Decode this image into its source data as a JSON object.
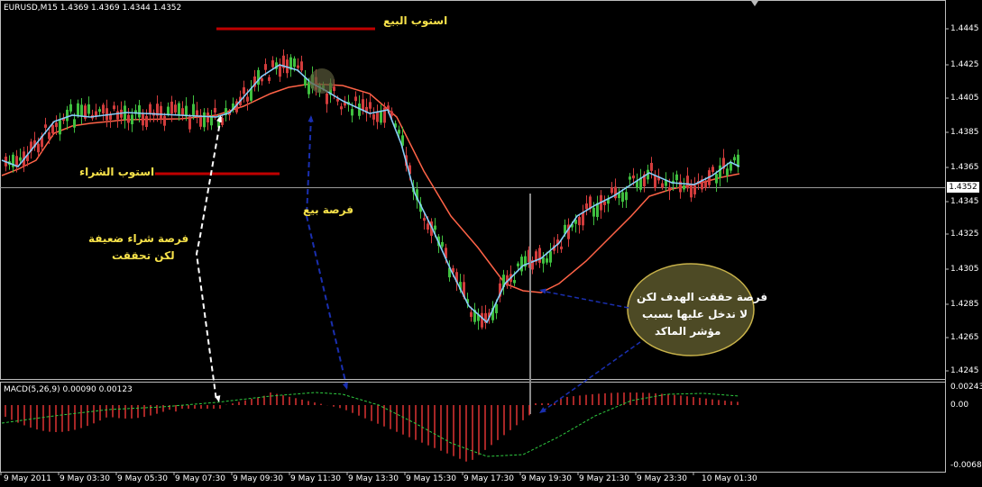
{
  "header": {
    "symbol_info": "EURUSD,M15  1.4369 1.4369 1.4344 1.4352"
  },
  "macd": {
    "label": "MACD(5,26,9) 0.00090 0.00123",
    "scale_top": "0.00243",
    "scale_zero": "0.00",
    "scale_bottom": "-0.0068"
  },
  "price_axis": [
    "1.4445",
    "1.4425",
    "1.4405",
    "1.4385",
    "1.4365",
    "1.4345",
    "1.4325",
    "1.4305",
    "1.4285",
    "1.4265",
    "1.4245"
  ],
  "current_price": "1.4352",
  "time_axis": [
    "9 May 2011",
    "9 May 03:30",
    "9 May 05:30",
    "9 May 07:30",
    "9 May 09:30",
    "9 May 11:30",
    "9 May 13:30",
    "9 May 15:30",
    "9 May 17:30",
    "9 May 19:30",
    "9 May 21:30",
    "9 May 23:30",
    "10 May 01:30"
  ],
  "annotations": {
    "sell_stop": "استوب البيع",
    "buy_stop": "استوب الشراء",
    "weak_buy_line1": "فرصة شراء ضعيفة",
    "weak_buy_line2": "لكن تحققت",
    "sell_opportunity": "فرصة بيع",
    "bubble_line1": "فرصة حققت الهدف لكن",
    "bubble_line2": "لا ندخل عليها بسبب",
    "bubble_line3": "مؤشر الماكد"
  },
  "colors": {
    "bull": "#3fbf3f",
    "bear": "#d23c3c",
    "fast_ma": "#87cefa",
    "slow_ma": "#ff6347",
    "macd_hist": "#ff3b3b",
    "signal": "#2ecc40",
    "stop_line": "#c00000",
    "annotation_text": "#f7e24a",
    "arrow_blue": "#1a2fb0"
  }
}
